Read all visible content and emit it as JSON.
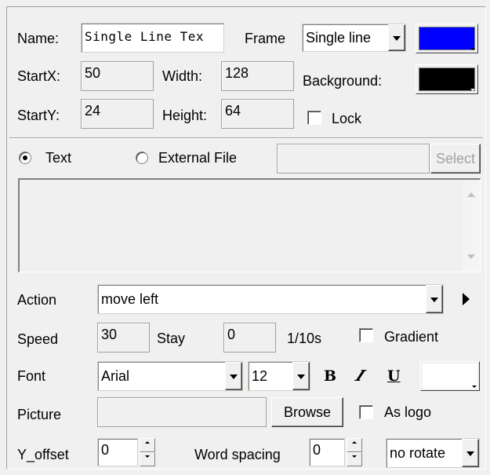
{
  "labels": {
    "name": "Name:",
    "frame": "Frame",
    "startx": "StartX:",
    "width": "Width:",
    "background": "Background:",
    "starty": "StartY:",
    "height": "Height:",
    "lock": "Lock",
    "text": "Text",
    "external_file": "External File",
    "action": "Action",
    "speed": "Speed",
    "stay": "Stay",
    "unit": "1/10s",
    "gradient": "Gradient",
    "font": "Font",
    "picture": "Picture",
    "as_logo": "As logo",
    "y_offset": "Y_offset",
    "word_spacing": "Word spacing"
  },
  "values": {
    "name": "Single Line Tex",
    "frame": "Single line",
    "startx": "50",
    "width": "128",
    "starty": "24",
    "height": "64",
    "external_file": "",
    "text_content": "",
    "action": "move left",
    "speed": "30",
    "stay": "0",
    "font": "Arial",
    "font_size": "12",
    "picture": "",
    "y_offset": "0",
    "word_spacing": "0",
    "rotate": "no rotate"
  },
  "buttons": {
    "select": "Select",
    "browse": "Browse",
    "bold": "B",
    "italic": "I",
    "underline": "U"
  },
  "state": {
    "lock_checked": false,
    "text_selected": true,
    "gradient_checked": false,
    "as_logo_checked": false
  },
  "colors": {
    "frame_color": "#0000ff",
    "background_color": "#000000",
    "font_color": "#ffffff"
  }
}
